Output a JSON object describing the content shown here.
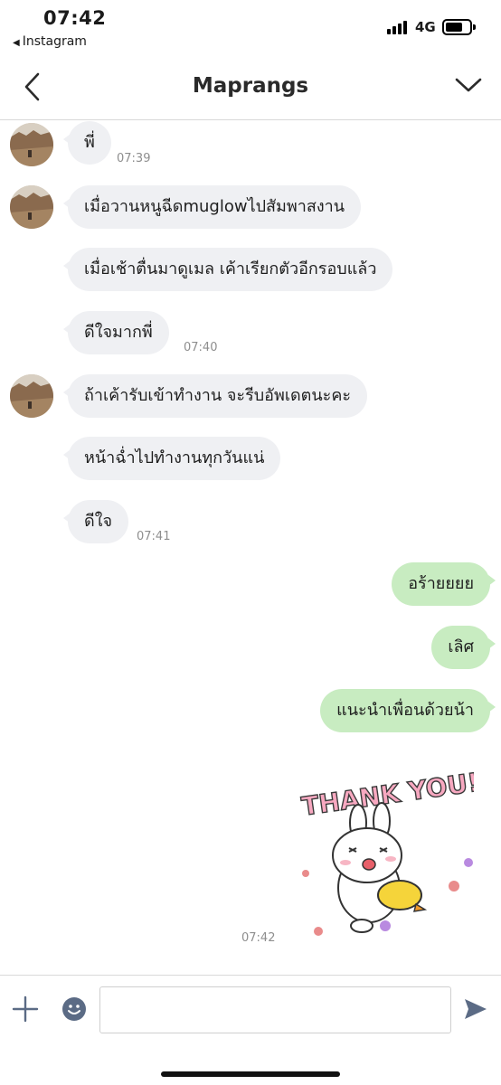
{
  "status_bar": {
    "time": "07:42",
    "back_app": "Instagram",
    "network": "4G",
    "battery_level": 0.65
  },
  "header": {
    "title": "Maprangs"
  },
  "messages": [
    {
      "side": "in",
      "text": "พี่",
      "time": "07:39"
    },
    {
      "side": "in",
      "text": "เมื่อวานหนูฉีดmuglowไปสัมพาสงาน"
    },
    {
      "side": "in",
      "text": "เมื่อเช้าตื่นมาดูเมล เค้าเรียกตัวอีกรอบแล้ว"
    },
    {
      "side": "in",
      "text": "ดีใจมากพี่",
      "time": "07:40"
    },
    {
      "side": "in",
      "text": "ถ้าเค้ารับเข้าทำงาน จะรีบอัพเดตนะคะ"
    },
    {
      "side": "in",
      "text": "หน้าฉ่ำไปทำงานทุกวันแน่"
    },
    {
      "side": "in",
      "text": "ดีใจ",
      "time": "07:41"
    },
    {
      "side": "out",
      "text": "อร้ายยยย"
    },
    {
      "side": "out",
      "text": "เลิศ"
    },
    {
      "side": "out",
      "text": "แนะนำเพื่อนด้วยน้า"
    }
  ],
  "sticker": {
    "caption": "THANK YOU!",
    "time": "07:42"
  },
  "input": {
    "placeholder": ""
  },
  "colors": {
    "incoming_bubble": "#eff0f3",
    "outgoing_bubble": "#c8ecc1",
    "timestamp": "#8e8e8e",
    "icon": "#5b6b85"
  },
  "icons": [
    "back-chevron-icon",
    "menu-chevron-down-icon",
    "plus-icon",
    "emoji-icon",
    "send-icon"
  ]
}
